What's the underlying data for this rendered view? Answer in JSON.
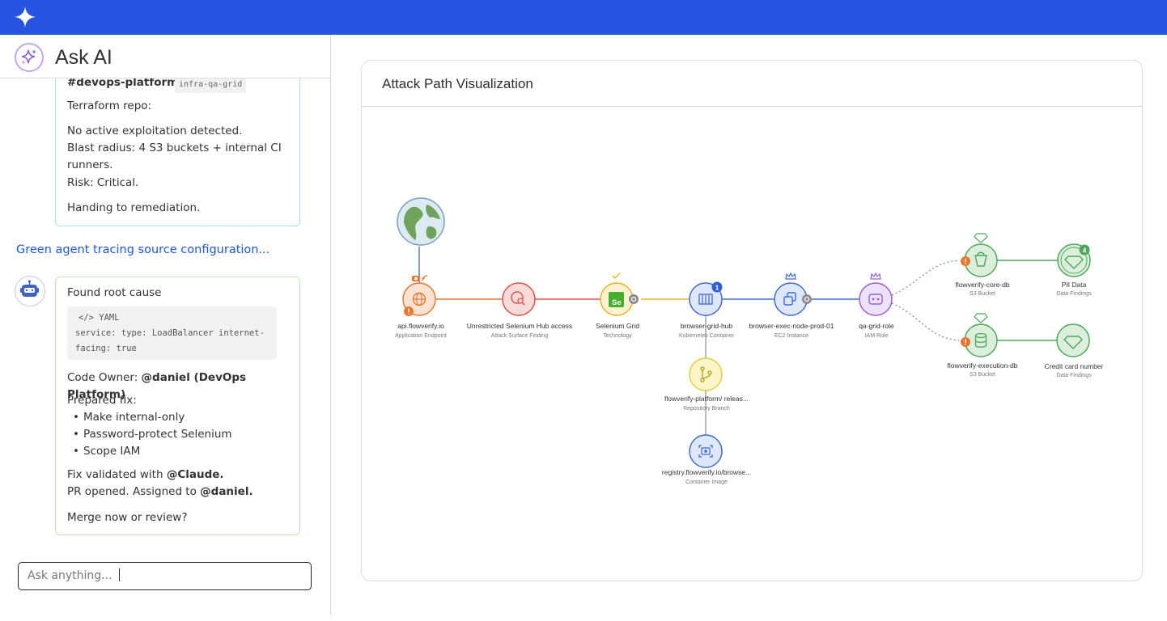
{
  "topbar": {
    "logo_icon": "sparkle-icon",
    "color": "#2454e0"
  },
  "chat": {
    "title": "Ask AI",
    "prev_message": {
      "partial_heading": "#devops-platform)",
      "tag": "infra-qa-grid",
      "terraform": "Terraform repo:",
      "lines": [
        "No active exploitation detected.",
        "Blast radius: 4 S3 buckets + internal CI runners.",
        "Risk: Critical."
      ],
      "handing": "Handing to remediation."
    },
    "status_link": "Green agent tracing source configuration...",
    "agent_message": {
      "root": "Found root cause",
      "code_lang": "</> YAML",
      "code_line1": "service: type: LoadBalancer internet-",
      "code_line2": "facing: true",
      "owner_prefix": "Code Owner: ",
      "owner": "@daniel (DevOps Platform)",
      "prepared": "Prepared fix:",
      "fixes": [
        "Make internal-only",
        "Password-protect Selenium",
        "Scope IAM"
      ],
      "validated_prefix": "Fix validated with ",
      "validated_by": "@Claude.",
      "pr_prefix": "PR opened. Assigned to ",
      "pr_assignee": "@daniel.",
      "question": "Merge now or review?"
    },
    "input_placeholder": "Ask anything..."
  },
  "viz": {
    "title": "Attack Path Visualization",
    "nodes": {
      "internet": {
        "icon": "globe-icon"
      },
      "api": {
        "name": "api.flowverify.io",
        "type": "Application Endpoint",
        "color": "#e8772e"
      },
      "hub": {
        "name": "Unrestricted Selenium Hub access",
        "type": "Attack Surface Finding",
        "color": "#e0504a"
      },
      "grid": {
        "name": "Selenium Grid",
        "type": "Technology",
        "color": "#e6b42c"
      },
      "bgh": {
        "name": "browser-grid-hub",
        "type": "Kubernetes Container",
        "color": "#3e6bd6",
        "badge": "1"
      },
      "exec": {
        "name": "browser-exec-node-prod-01",
        "type": "EC2 Instance",
        "color": "#3e6bd6"
      },
      "role": {
        "name": "qa-grid-role",
        "type": "IAM Role",
        "color": "#9b5dd6"
      },
      "coredb": {
        "name": "flowverify-core-db",
        "type": "S3 Bucket",
        "color": "#4fa85a"
      },
      "pii": {
        "name": "PII Data",
        "type": "Data Findings",
        "color": "#4fa85a",
        "badge": "4"
      },
      "execdb": {
        "name": "flowverify-execution-db",
        "type": "S3 Bucket",
        "color": "#4fa85a"
      },
      "cc": {
        "name": "Credit card number",
        "type": "Data Findings",
        "color": "#4fa85a"
      },
      "branch": {
        "name": "flowverify-platform/ releas...",
        "type": "Repository Branch",
        "color": "#e4cf3d"
      },
      "image": {
        "name": "registry.flowverify.io/browse...",
        "type": "Container Image",
        "color": "#3e6bd6"
      }
    }
  }
}
